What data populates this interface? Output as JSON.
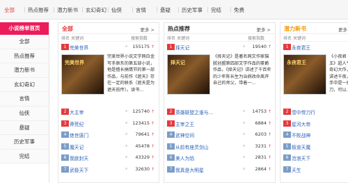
{
  "topnav": {
    "items": [
      "全部",
      "热点推荐",
      "潜力新书",
      "玄幻奇幻",
      "仙侠",
      "言情",
      "悬疑",
      "历史军事",
      "完结",
      "免费"
    ],
    "active_index": 0
  },
  "sidebar": {
    "title": "小说榜单首页",
    "items": [
      "全部",
      "热点推荐",
      "潜力新书",
      "玄幻奇幻",
      "言情",
      "仙侠",
      "悬疑",
      "历史军事",
      "完结"
    ]
  },
  "panels": [
    {
      "title": "全部",
      "title_color": "#e4393c",
      "more": "更多 >",
      "cols": [
        "排名",
        "关键词",
        "搜索指数"
      ],
      "top": {
        "rank": "1",
        "name": "完美世界",
        "count": "155175",
        "cover_text": "完美世界",
        "desc": "完美世界小说文学网白金写手辰东的第五部小说，他是擅长搞情节的第一部作品，与前作《遮天》存在一定的联系（遮天是为遮天前传）。读书...",
        "desc_highlight": "（遮天是为遮天前传）"
      },
      "rows": [
        {
          "rank": "2",
          "name": "大主宰",
          "count": "125740"
        },
        {
          "rank": "3",
          "name": "莽荒纪",
          "count": "123415"
        },
        {
          "rank": "4",
          "name": "绝世唐门",
          "count": "79641"
        },
        {
          "rank": "5",
          "name": "魔天记",
          "count": "45478"
        },
        {
          "rank": "6",
          "name": "我欲封天",
          "count": "43329"
        },
        {
          "rank": "7",
          "name": "武极天下",
          "count": "32630"
        }
      ]
    },
    {
      "title": "热点推荐",
      "title_color": "#333333",
      "more": "更多 >",
      "cols": [
        "排名",
        "关键词",
        "搜索指数"
      ],
      "top": {
        "rank": "1",
        "name": "择天记",
        "count": "19540",
        "cover_text": "择天记",
        "desc": "《择天记》是著名网文作家猫腻创盟第四部文学作品的豪爵作品，《择天记》讲述了千百年的少年陈长生为治病改命离开自己的师父，带着一...",
        "desc_highlight": ""
      },
      "rows": [
        {
          "rank": "2",
          "name": "英雄联盟之谁与…",
          "count": "14753"
        },
        {
          "rank": "3",
          "name": "主宰之王",
          "count": "6884"
        },
        {
          "rank": "4",
          "name": "武神空间",
          "count": "6203"
        },
        {
          "rank": "5",
          "name": "从前有座灵剑山",
          "count": "3231"
        },
        {
          "rank": "6",
          "name": "美人为馅",
          "count": "2831"
        },
        {
          "rank": "7",
          "name": "我真是大明星",
          "count": "2864"
        }
      ]
    },
    {
      "title": "潜力新书",
      "title_color": "#f39800",
      "more": "更多",
      "cols": [
        "排名",
        "关键词"
      ],
      "top": {
        "rank": "1",
        "name": "永夜君王",
        "count": "",
        "cover_text": "永夜君王",
        "desc": "《小夜君王》超人气奇幻大作，讲述千夜，手中是一把刀，可以…",
        "desc_highlight": ""
      },
      "rows": [
        {
          "rank": "2",
          "name": "雪中悍刀行",
          "count": ""
        },
        {
          "rank": "3",
          "name": "星河大帝",
          "count": ""
        },
        {
          "rank": "4",
          "name": "不败战神",
          "count": ""
        },
        {
          "rank": "5",
          "name": "极道天魔",
          "count": ""
        },
        {
          "rank": "6",
          "name": "沧浪天下",
          "count": ""
        },
        {
          "rank": "7",
          "name": "天生",
          "count": ""
        }
      ]
    }
  ],
  "colors": {
    "rank_top3": "#e4393c",
    "rank_other": "#7a9cc6",
    "link": "#2b62b8",
    "sidebar_head": "#ec1c5a"
  }
}
